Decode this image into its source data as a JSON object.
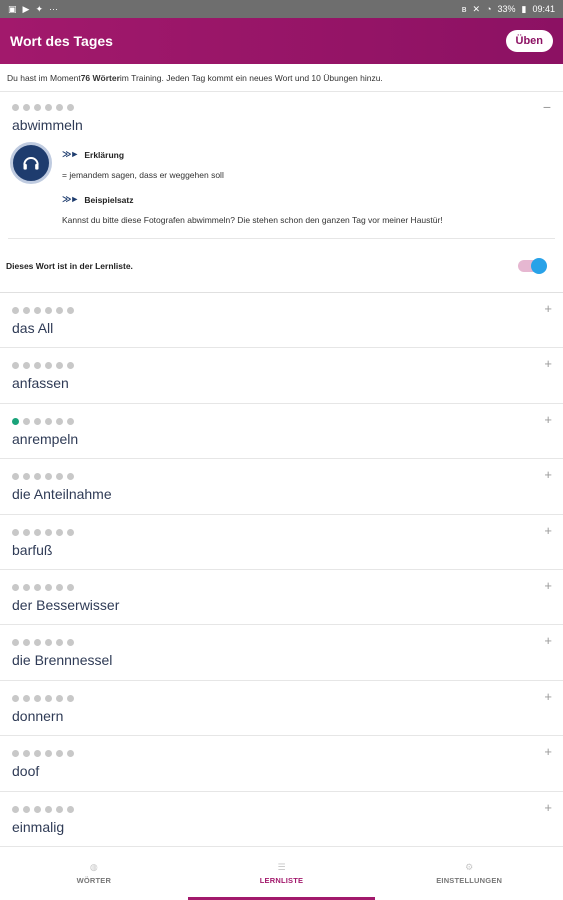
{
  "status_bar": {
    "left_icons": [
      "gallery-icon",
      "play-store-icon",
      "notification-icon",
      "more-icon"
    ],
    "right": {
      "battery": "33%",
      "time": "09:41"
    },
    "right_icons": [
      "bluetooth-icon",
      "mute-icon",
      "wifi-icon",
      "battery-icon"
    ]
  },
  "app_bar": {
    "title": "Wort des Tages",
    "practice_label": "Üben"
  },
  "intro": {
    "prefix": "Du hast im Moment ",
    "count": "76 Wörter",
    "suffix": " im Training. Jeden Tag kommt ein neues Wort und 10 Übungen hinzu."
  },
  "expanded": {
    "word": "abwimmeln",
    "progress": 0,
    "explanation_label": "Erklärung",
    "explanation": "= jemandem sagen, dass er weggehen soll",
    "example_label": "Beispielsatz",
    "example": "Kannst du bitte diese Fotografen abwimmeln? Die stehen schon den ganzen Tag vor meiner Haustür!",
    "learnlist_label": "Dieses Wort ist in der Lernliste.",
    "in_learnlist": true
  },
  "words": [
    {
      "word": "das All",
      "progress": 0
    },
    {
      "word": "anfassen",
      "progress": 0
    },
    {
      "word": "anrempeln",
      "progress": 1
    },
    {
      "word": "die Anteilnahme",
      "progress": 0
    },
    {
      "word": "barfuß",
      "progress": 0
    },
    {
      "word": "der Besserwisser",
      "progress": 0
    },
    {
      "word": "die Brennnessel",
      "progress": 0
    },
    {
      "word": "donnern",
      "progress": 0
    },
    {
      "word": "doof",
      "progress": 0
    },
    {
      "word": "einmalig",
      "progress": 0
    }
  ],
  "bottom_nav": [
    {
      "label": "WÖRTER",
      "icon": "words-icon",
      "active": false
    },
    {
      "label": "LERNLISTE",
      "icon": "list-icon",
      "active": true
    },
    {
      "label": "EINSTELLUNGEN",
      "icon": "settings-icon",
      "active": false
    }
  ],
  "colors": {
    "brand": "#a2196c",
    "progress_done": "#1aa37a",
    "progress_todo": "#c8c8c8",
    "word_text": "#2f3b56",
    "toggle_knob": "#29a2e8"
  }
}
